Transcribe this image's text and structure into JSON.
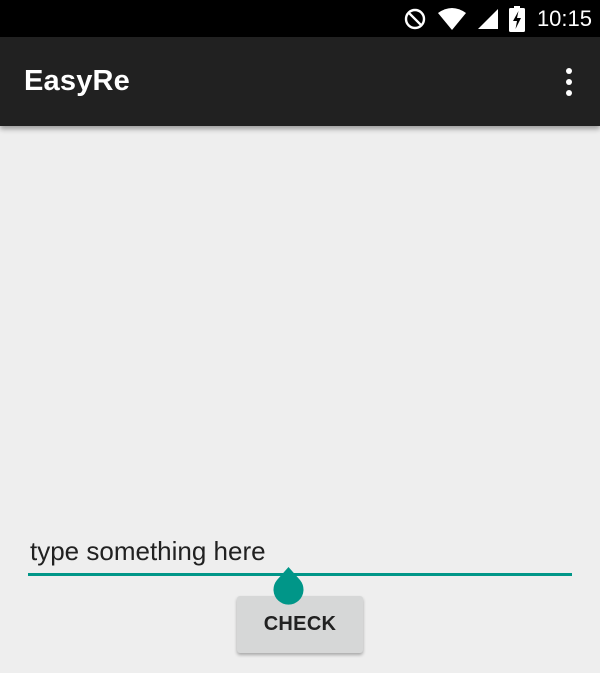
{
  "status_bar": {
    "time": "10:15",
    "icons": [
      "do-not-disturb-icon",
      "wifi-icon",
      "signal-icon",
      "battery-charging-icon"
    ]
  },
  "app_bar": {
    "title": "EasyRe",
    "menu_icon": "overflow-menu-icon"
  },
  "form": {
    "input_value": "type something here",
    "button_label": "CHECK"
  },
  "colors": {
    "accent": "#009688",
    "app_bar": "#212121",
    "status_bar": "#000000",
    "background": "#eeeeee",
    "button": "#d6d7d7"
  }
}
